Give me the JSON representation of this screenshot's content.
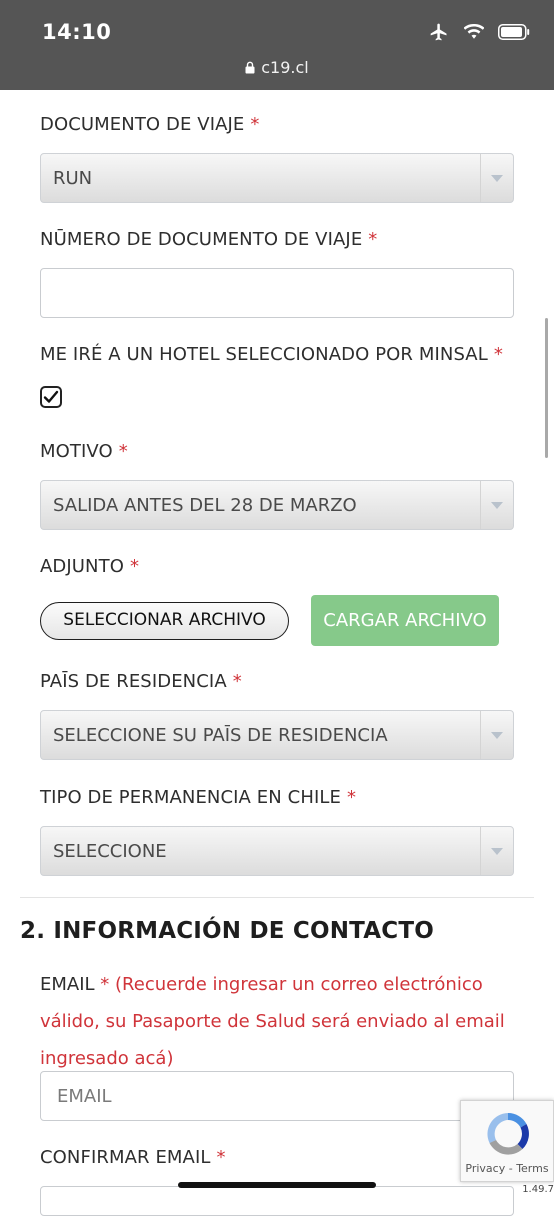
{
  "status_bar": {
    "time": "14:10",
    "url": "c19.cl"
  },
  "required_mark": "*",
  "form": {
    "documento": {
      "label": "DOCUMENTO DE VIAJE",
      "value": "RUN"
    },
    "numero": {
      "label": "NŪMERO DE DOCUMENTO DE VIAJE",
      "value": ""
    },
    "hotel": {
      "label": "ME IRÉ A UN HOTEL SELECCIONADO POR MINSAL",
      "checked": true
    },
    "motivo": {
      "label": "MOTIVO",
      "value": "SALIDA ANTES DEL 28 DE MARZO"
    },
    "adjunto": {
      "label": "ADJUNTO",
      "select_button": "SELECCIONAR ARCHIVO",
      "upload_button": "CARGAR ARCHIVO"
    },
    "pais": {
      "label": "PAĪS DE RESIDENCIA",
      "value": "SELECCIONE SU PAĪS DE RESIDENCIA"
    },
    "permanencia": {
      "label": "TIPO DE PERMANENCIA EN CHILE",
      "value": "SELECCIONE"
    }
  },
  "contact": {
    "title": "2. INFORMACIÓN DE CONTACTO",
    "email": {
      "label": "EMAIL",
      "note": "(Recuerde ingresar un correo electrónico válido, su Pasaporte de Salud será enviado al email ingresado acá)",
      "placeholder": "EMAIL"
    },
    "confirm_email": {
      "label": "CONFIRMAR EMAIL"
    }
  },
  "recaptcha": {
    "privacy": "Privacy",
    "separator": " - ",
    "terms": "Terms",
    "version": "1.49.7"
  },
  "colors": {
    "required": "#d0343a",
    "upload_button": "#86c98a",
    "status_bar": "#555555"
  }
}
